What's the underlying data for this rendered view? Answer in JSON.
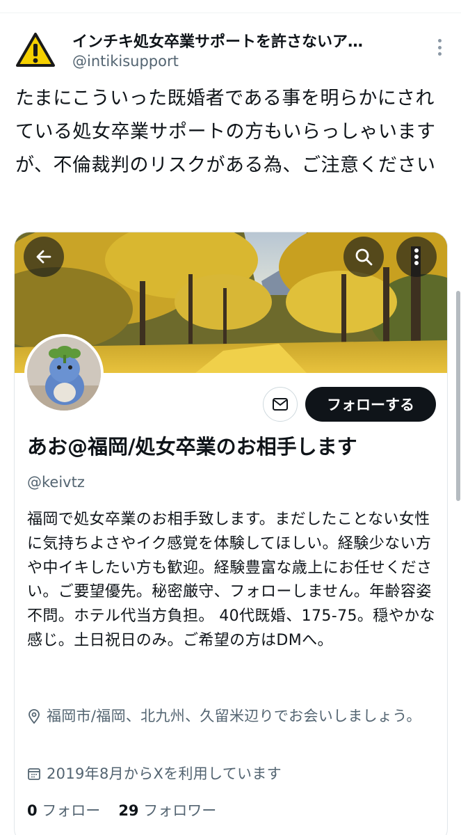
{
  "tweet": {
    "author_name": "インチキ処女卒業サポートを許さないア…",
    "author_handle": "@intikisupport",
    "avatar_icon": "warning-icon",
    "text": "たまにこういった既婚者である事を明らかにされている処女卒業サポートの方もいらっしゃいますが、不倫裁判のリスクがある為、ご注意ください"
  },
  "profile_card": {
    "follow_label": "フォローする",
    "display_name": "あお@福岡/処女卒業のお相手します",
    "handle": "@keivtz",
    "bio": "福岡で処女卒業のお相手致します。まだしたことない女性に気持ちよさやイク感覚を体験してほしい。経験少ない方や中イキしたい方も歓迎。経験豊富な歳上にお任せください。ご要望優先。秘密厳守、フォローしません。年齢容姿不問。ホテル代当方負担。 40代既婚、175-75。穏やかな感じ。土日祝日のみ。ご希望の方はDMへ。",
    "location": "福岡市/福岡、北九州、久留米辺りでお会いしましょう。",
    "joined": "2019年8月からXを利用しています",
    "following_count": "0",
    "following_label": "フォロー",
    "followers_count": "29",
    "followers_label": "フォロワー"
  },
  "colors": {
    "text_primary": "#0f1419",
    "text_secondary": "#536471",
    "follow_button_bg": "#0f1419",
    "warning_yellow": "#f5d000"
  }
}
